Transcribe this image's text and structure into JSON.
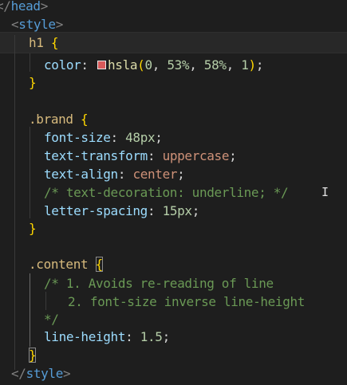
{
  "code": {
    "head_tag": "head",
    "style_open": "style",
    "style_close": "style",
    "h1_selector": "h1",
    "brace_open": "{",
    "brace_close": "}",
    "color_prop": "color",
    "colon": ":",
    "semicolon": ";",
    "color_fn": "hsla",
    "color_args": {
      "a": "0",
      "b": "53%",
      "c": "58%",
      "d": "1",
      "comma": ","
    },
    "brand_selector": ".brand",
    "font_size_prop": "font-size",
    "font_size_val": "48px",
    "text_transform_prop": "text-transform",
    "text_transform_val": "uppercase",
    "text_align_prop": "text-align",
    "text_align_val": "center",
    "commented_line": "/* text-decoration: underline; */",
    "letter_spacing_prop": "letter-spacing",
    "letter_spacing_val": "15px",
    "content_selector": ".content",
    "comment_line_1": "/* 1. Avoids re-reading of line",
    "comment_line_2": "2. font-size inverse line-height",
    "comment_line_3": "*/",
    "line_height_prop": "line-height",
    "line_height_val": "1.5"
  },
  "swatch_color": "#d85a5a",
  "mouse_cursor_icon": "text-ibeam-cursor"
}
